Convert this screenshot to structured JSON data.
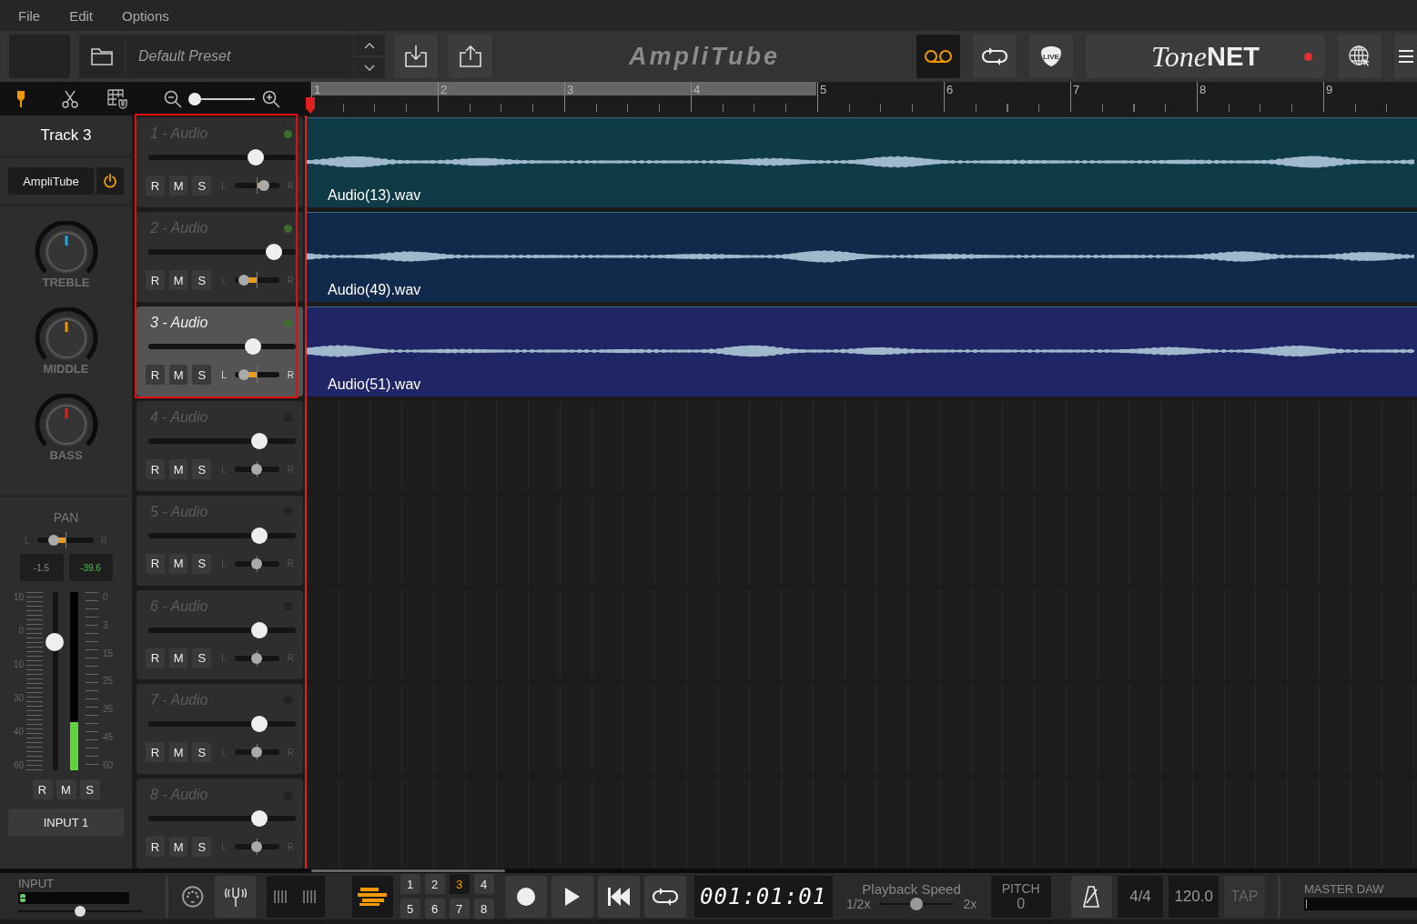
{
  "menu": [
    {
      "label": "File"
    },
    {
      "label": "Edit"
    },
    {
      "label": "Options"
    }
  ],
  "toolbar": {
    "preset": "Default Preset",
    "logo": "AmpliTube",
    "loop_record_on": true,
    "live_badge": "LIVE",
    "tonenet_script": "Tone",
    "tonenet_bold": "NET",
    "tonenet_connected": true
  },
  "zoom": {
    "level": 0.04
  },
  "ruler": {
    "bars": [
      "1",
      "2",
      "3",
      "4",
      "5",
      "6",
      "7",
      "8",
      "9"
    ]
  },
  "channel": {
    "track_name": "Track 3",
    "plugin": "AmpliTube",
    "plugin_on": true,
    "knobs": [
      {
        "label": "TREBLE",
        "level": 0.5,
        "color": "#1ea7e1"
      },
      {
        "label": "MIDDLE",
        "level": 0.5,
        "color": "#f39200"
      },
      {
        "label": "BASS",
        "level": 0.5,
        "color": "#e02020"
      }
    ],
    "pan_label": "PAN",
    "pan_left": "L",
    "pan_right": "R",
    "pan": {
      "level": 0.3
    },
    "readouts": [
      {
        "value": "-1.5",
        "kind": "pan"
      },
      {
        "value": "-39.6",
        "kind": "level"
      }
    ],
    "fader_scale": [
      "10",
      "0",
      "10",
      "30",
      "40",
      "60"
    ],
    "meter_scale": [
      "0",
      "3",
      "15",
      "25",
      "35",
      "45",
      "60"
    ],
    "fader": {
      "level": 0.72
    },
    "meter": {
      "level": 0.27
    },
    "buttons": [
      "R",
      "M",
      "S"
    ],
    "input": "INPUT 1"
  },
  "tracks": [
    {
      "name": "1 - Audio",
      "selected": false,
      "active": true,
      "highlighted": true,
      "volume": {
        "level": 0.73
      },
      "pan": {
        "level": 0.65
      },
      "buttons": [
        "R",
        "M",
        "S"
      ],
      "pan_left": "L",
      "pan_right": "R",
      "clip": {
        "name": "Audio(13).wav",
        "color": "#0f3b47"
      }
    },
    {
      "name": "2 - Audio",
      "selected": false,
      "active": true,
      "highlighted": true,
      "volume": {
        "level": 0.85
      },
      "pan": {
        "level": 0.21
      },
      "buttons": [
        "R",
        "M",
        "S"
      ],
      "pan_left": "L",
      "pan_right": "R",
      "clip": {
        "name": "Audio(49).wav",
        "color": "#112a4b"
      }
    },
    {
      "name": "3 - Audio",
      "selected": true,
      "active": true,
      "highlighted": true,
      "volume": {
        "level": 0.71
      },
      "pan": {
        "level": 0.21
      },
      "buttons": [
        "R",
        "M",
        "S"
      ],
      "pan_left": "L",
      "pan_right": "R",
      "clip": {
        "name": "Audio(51).wav",
        "color": "#1f2565"
      }
    },
    {
      "name": "4 - Audio",
      "selected": false,
      "active": false,
      "highlighted": false,
      "volume": {
        "level": 0.75
      },
      "pan": {
        "level": 0.5
      },
      "buttons": [
        "R",
        "M",
        "S"
      ],
      "pan_left": "L",
      "pan_right": "R"
    },
    {
      "name": "5 - Audio",
      "selected": false,
      "active": false,
      "highlighted": false,
      "volume": {
        "level": 0.75
      },
      "pan": {
        "level": 0.5
      },
      "buttons": [
        "R",
        "M",
        "S"
      ],
      "pan_left": "L",
      "pan_right": "R"
    },
    {
      "name": "6 - Audio",
      "selected": false,
      "active": false,
      "highlighted": false,
      "volume": {
        "level": 0.75
      },
      "pan": {
        "level": 0.5
      },
      "buttons": [
        "R",
        "M",
        "S"
      ],
      "pan_left": "L",
      "pan_right": "R"
    },
    {
      "name": "7 - Audio",
      "selected": false,
      "active": false,
      "highlighted": false,
      "volume": {
        "level": 0.75
      },
      "pan": {
        "level": 0.5
      },
      "buttons": [
        "R",
        "M",
        "S"
      ],
      "pan_left": "L",
      "pan_right": "R"
    },
    {
      "name": "8 - Audio",
      "selected": false,
      "active": false,
      "highlighted": false,
      "volume": {
        "level": 0.75
      },
      "pan": {
        "level": 0.5
      },
      "buttons": [
        "R",
        "M",
        "S"
      ],
      "pan_left": "L",
      "pan_right": "R"
    }
  ],
  "transport": {
    "input_label": "INPUT",
    "input_meter": {
      "level": 0.05
    },
    "input_gain": {
      "level": 0.5
    },
    "scenes": [
      {
        "label": "1",
        "selected": false
      },
      {
        "label": "2",
        "selected": false
      },
      {
        "label": "3",
        "selected": true
      },
      {
        "label": "4",
        "selected": false
      },
      {
        "label": "5",
        "selected": false
      },
      {
        "label": "6",
        "selected": false
      },
      {
        "label": "7",
        "selected": false
      },
      {
        "label": "8",
        "selected": false
      }
    ],
    "time": "001:01:01",
    "speed_label": "Playback Speed",
    "speed_min": "1/2x",
    "speed_max": "2x",
    "speed": {
      "level": 0.5
    },
    "pitch_label": "PITCH",
    "pitch": "0",
    "time_signature": "4/4",
    "tempo": "120.0",
    "tap": "TAP",
    "master_label": "MASTER DAW",
    "master_meter": {
      "level": 0.01
    }
  }
}
